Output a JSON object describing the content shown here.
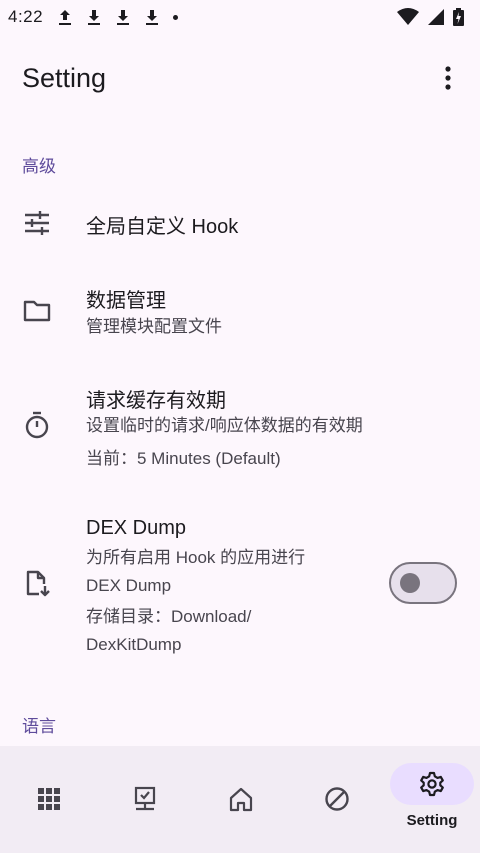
{
  "status_bar": {
    "time": "4:22"
  },
  "app_bar": {
    "title": "Setting"
  },
  "sections": {
    "advanced": "高级",
    "language": "语言"
  },
  "items": {
    "global_hook": {
      "title": "全局自定义 Hook"
    },
    "data_manage": {
      "title": "数据管理",
      "subtitle": "管理模块配置文件"
    },
    "cache": {
      "title": "请求缓存有效期",
      "subtitle": "设置临时的请求/响应体数据的有效期",
      "current": "当前：5 Minutes (Default)"
    },
    "dex_dump": {
      "title": "DEX Dump",
      "subtitle_line1": "为所有启用 Hook 的应用进行",
      "subtitle_line2": "DEX Dump",
      "path_line1": "存储目录：Download/",
      "path_line2": "DexKitDump",
      "enabled": false
    }
  },
  "bottom_nav": {
    "items": [
      {
        "icon": "apps-icon"
      },
      {
        "icon": "install-desktop-icon"
      },
      {
        "icon": "home-icon"
      },
      {
        "icon": "block-icon"
      },
      {
        "icon": "settings-icon",
        "label": "Setting",
        "selected": true
      }
    ]
  },
  "colors": {
    "accent": "#5e4b9b",
    "background": "#fdf7fd",
    "nav_bg": "#f2ecf4",
    "pill": "#e9ddff"
  }
}
